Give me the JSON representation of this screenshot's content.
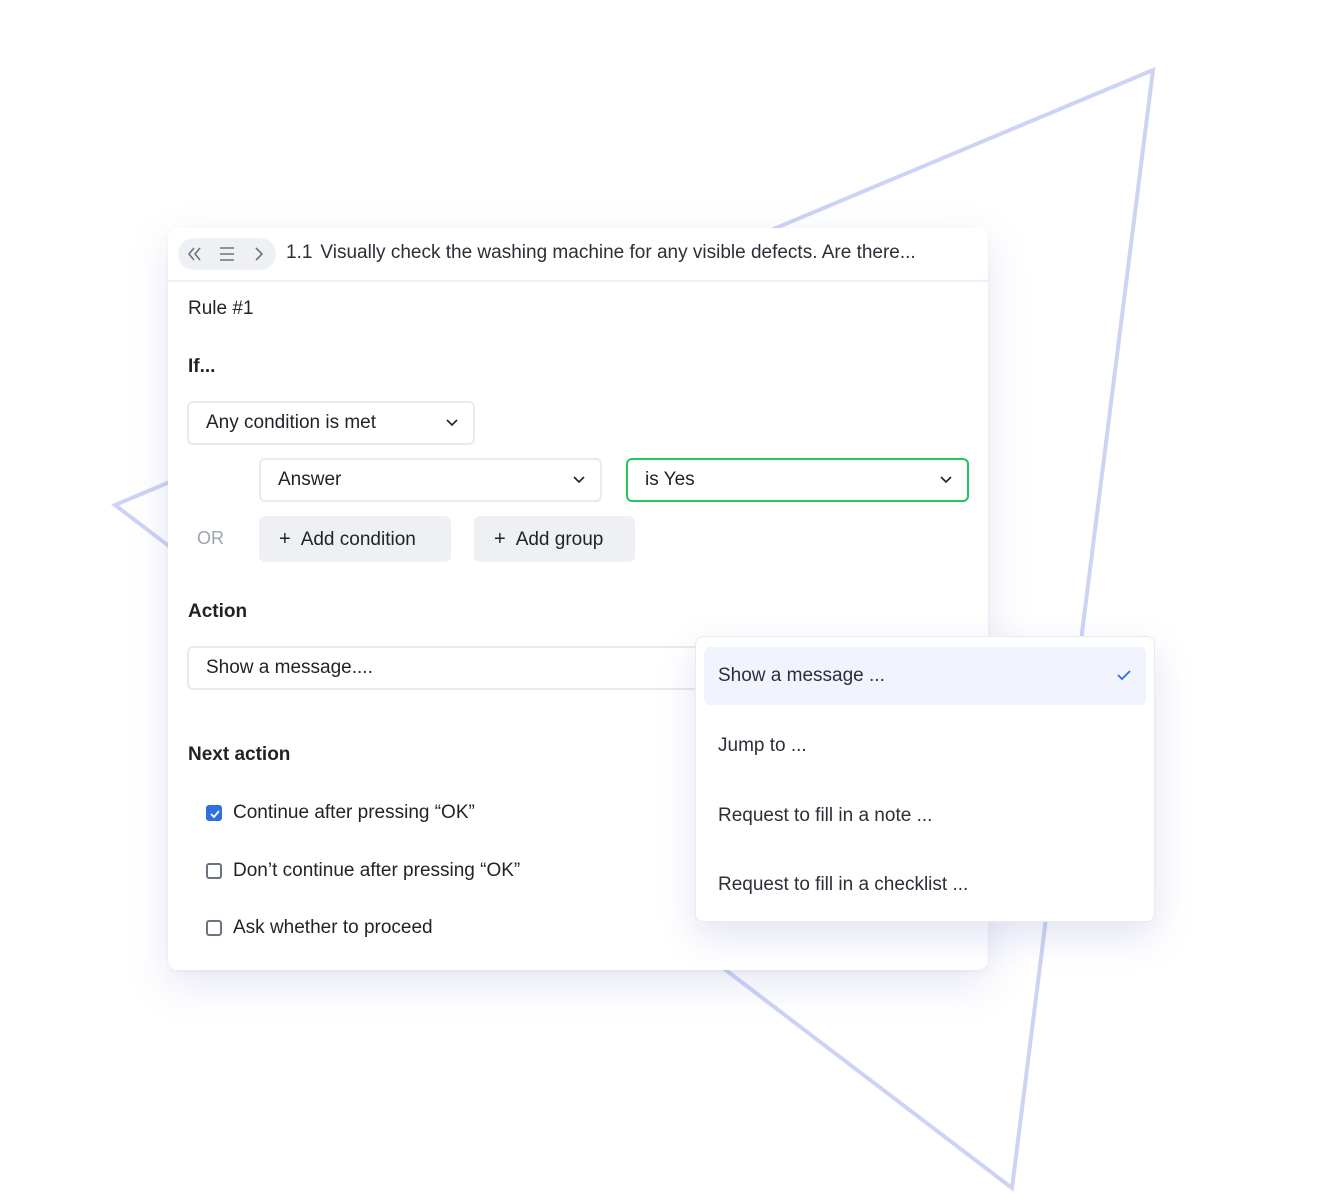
{
  "header": {
    "question_number": "1.1",
    "question_text": "Visually check the washing machine for any visible defects. Are there...",
    "nav_icons": [
      "double-chevron-left-icon",
      "menu-icon",
      "chevron-right-icon"
    ]
  },
  "rule": {
    "title": "Rule #1",
    "if_label": "If...",
    "match_mode": "Any condition is met",
    "condition": {
      "field": "Answer",
      "operator": "is Yes"
    },
    "connector": "OR",
    "add_condition": "Add condition",
    "add_group": "Add group"
  },
  "action": {
    "label": "Action",
    "selected": "Show a message...."
  },
  "next_action": {
    "label": "Next action",
    "options": [
      {
        "label": "Continue after pressing “OK”",
        "checked": true
      },
      {
        "label": "Don’t continue after pressing “OK”",
        "checked": false
      },
      {
        "label": "Ask whether to proceed",
        "checked": false
      }
    ]
  },
  "action_dropdown": {
    "items": [
      {
        "label": "Show a message ...",
        "selected": true
      },
      {
        "label": "Jump to ..."
      },
      {
        "label": "Request to fill in a note ..."
      },
      {
        "label": "Request to fill in a checklist ..."
      }
    ]
  },
  "colors": {
    "accent": "#2f6fde",
    "success_border": "#22c55e",
    "decor_stroke": "#cdd3f5"
  }
}
